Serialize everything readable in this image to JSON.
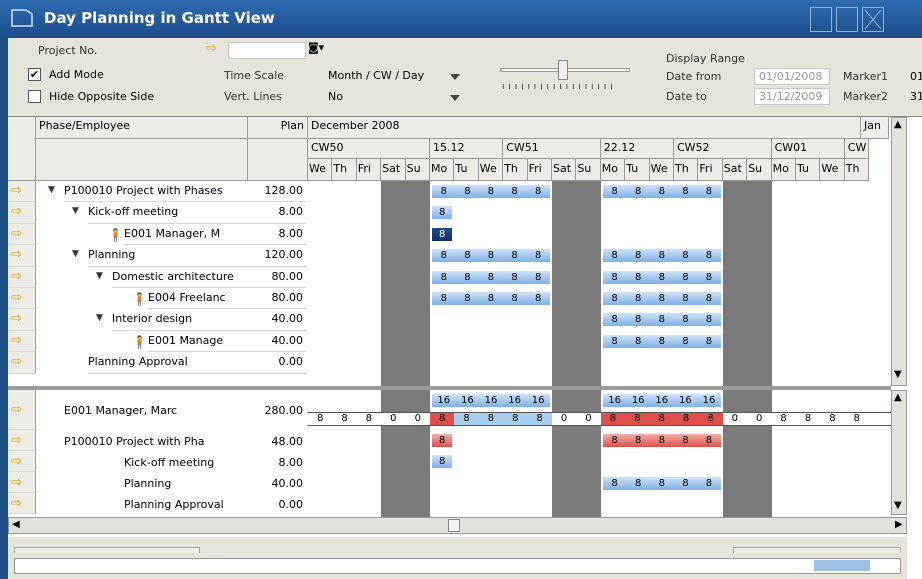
{
  "window": {
    "title": "Day Planning in Gantt View"
  },
  "controls": {
    "project_no_label": "Project No.",
    "add_mode_label": "Add Mode",
    "add_mode_checked": true,
    "hide_opposite_label": "Hide Opposite Side",
    "hide_opposite_checked": false,
    "time_scale_label": "Time Scale",
    "time_scale_value": "Month / CW / Day",
    "vert_lines_label": "Vert. Lines",
    "vert_lines_value": "No",
    "display_range_label": "Display Range",
    "date_from_label": "Date from",
    "date_from_value": "01/01/2008",
    "date_to_label": "Date to",
    "date_to_value": "31/12/2009",
    "marker1_label": "Marker1",
    "marker1_value": "01",
    "marker2_label": "Marker2",
    "marker2_value": "31"
  },
  "grid": {
    "col_phase": "Phase/Employee",
    "col_plan": "Plan",
    "month": "December 2008",
    "month2": "Jan",
    "cw": [
      "CW50",
      "15.12",
      "CW51",
      "22.12",
      "CW52",
      "CW01",
      "CW"
    ],
    "days": [
      "We",
      "Th",
      "Fri",
      "Sat",
      "Su",
      "Mo",
      "Tu",
      "We",
      "Th",
      "Fri",
      "Sat",
      "Su",
      "Mo",
      "Tu",
      "We",
      "Th",
      "Fri",
      "Sat",
      "Su",
      "Mo",
      "Tu",
      "We",
      "Th"
    ]
  },
  "rows_top": [
    {
      "label": "P100010  Project with Phases",
      "plan": "128.00"
    },
    {
      "label": "Kick-off meeting",
      "plan": "8.00"
    },
    {
      "label": "E001 Manager, M",
      "plan": "8.00"
    },
    {
      "label": "Planning",
      "plan": "120.00"
    },
    {
      "label": "Domestic architecture",
      "plan": "80.00"
    },
    {
      "label": "E004 Freelanc",
      "plan": "80.00"
    },
    {
      "label": "Interior design",
      "plan": "40.00"
    },
    {
      "label": "E001 Manage",
      "plan": "40.00"
    },
    {
      "label": "Planning Approval",
      "plan": "0.00"
    }
  ],
  "rows_bottom": [
    {
      "label": "E001 Manager, Marc",
      "plan": "280.00"
    },
    {
      "label": "P100010  Project with Pha",
      "plan": "48.00"
    },
    {
      "label": "Kick-off meeting",
      "plan": "8.00"
    },
    {
      "label": "Planning",
      "plan": "40.00"
    },
    {
      "label": "Planning Approval",
      "plan": "0.00"
    }
  ],
  "bar_values": {
    "sixteen": "16",
    "eight": "8",
    "zero": "0"
  },
  "colors": {
    "title_bg": "#2a62a6",
    "weekend": "#7a7a7a",
    "bar": "#7fb0e6",
    "overload": "#e0504a"
  }
}
